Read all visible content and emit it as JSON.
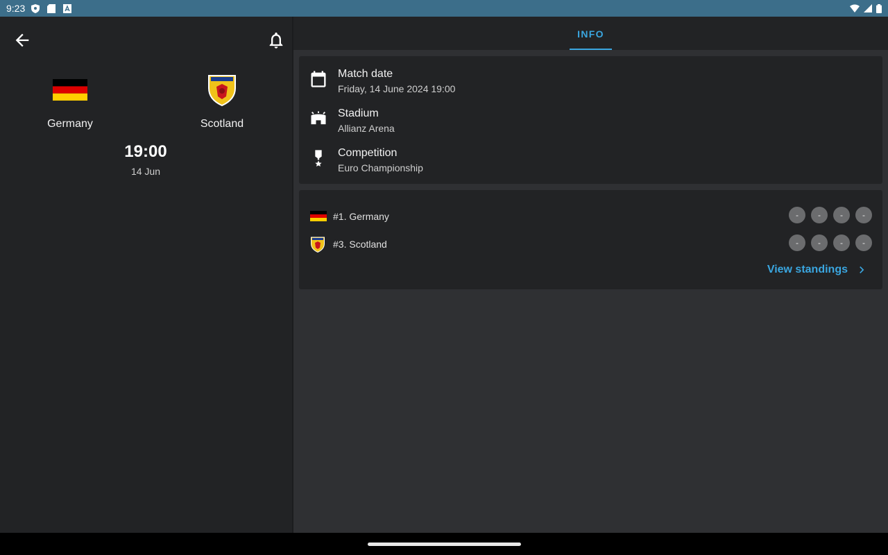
{
  "status_bar": {
    "time": "9:23"
  },
  "match": {
    "home": {
      "name": "Germany"
    },
    "away": {
      "name": "Scotland"
    },
    "kickoff_time": "19:00",
    "kickoff_date": "14 Jun"
  },
  "tabs": [
    {
      "label": "INFO",
      "active": true
    }
  ],
  "info": {
    "match_date_label": "Match date",
    "match_date_value": "Friday, 14 June 2024 19:00",
    "stadium_label": "Stadium",
    "stadium_value": "Allianz Arena",
    "competition_label": "Competition",
    "competition_value": "Euro Championship"
  },
  "standings": {
    "rows": [
      {
        "label": "#1. Germany",
        "form": [
          "-",
          "-",
          "-",
          "-"
        ]
      },
      {
        "label": "#3. Scotland",
        "form": [
          "-",
          "-",
          "-",
          "-"
        ]
      }
    ],
    "view_label": "View standings"
  },
  "colors": {
    "accent": "#3aa6e0",
    "status_bar": "#3c6e8a",
    "panel": "#222325",
    "background": "#2f3033"
  },
  "icons": [
    "back-arrow-icon",
    "bell-icon",
    "calendar-icon",
    "stadium-icon",
    "trophy-icon",
    "chevron-right-icon"
  ]
}
